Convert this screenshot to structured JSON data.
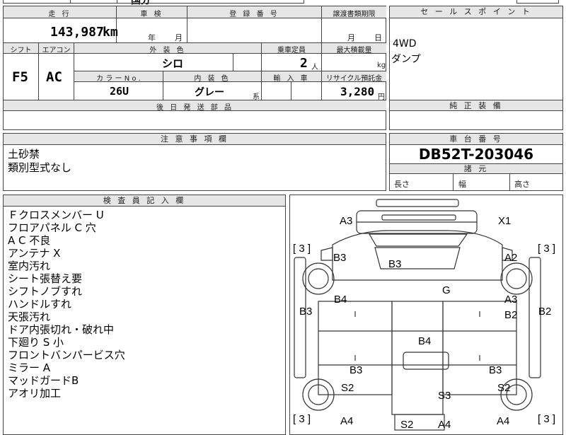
{
  "top_bar": {
    "partial_text": "国分"
  },
  "spec": {
    "headers": {
      "mileage": "走 行",
      "shaken": "車 検",
      "registration": "登 録 番 号",
      "transfer_deadline": "譲渡書類期限",
      "shift": "シフト",
      "aircon": "エアコン",
      "exterior_color": "外 装 色",
      "capacity": "乗車定員",
      "max_load": "最大積載量",
      "color_no": "カ ラ ー N o .",
      "interior_color": "内 装 色",
      "import": "輸 入 車",
      "recycle": "リサイクル預託金",
      "later_parts": "後 日 発 送 部 品"
    },
    "mileage_value": "143,987",
    "mileage_unit": "km",
    "shaken_year": "年",
    "shaken_month": "月",
    "transfer_month": "月",
    "transfer_day": "日",
    "shift_value": "F5",
    "aircon_value": "AC",
    "exterior_color_value": "シロ",
    "capacity_value": "2",
    "capacity_unit": "人",
    "load_unit": "kg",
    "color_no_value": "26U",
    "interior_color_value": "グレー",
    "interior_color_suffix": "系",
    "recycle_value": "3,280",
    "recycle_unit": "円"
  },
  "sales_points": {
    "header": "セ ー ル ス ポ イ ン ト",
    "lines": [
      "4WD",
      "ダンプ"
    ]
  },
  "genuine_equipment": {
    "header": "純 正 装 備"
  },
  "notes": {
    "header": "注 意 事 項 欄",
    "lines": [
      "土砂禁",
      "類別型式なし"
    ]
  },
  "chassis": {
    "header": "車 台 番 号",
    "number": "DB52T-203046"
  },
  "dimensions": {
    "header": "諸 元",
    "length": "長さ",
    "width": "幅",
    "height": "高さ"
  },
  "inspector": {
    "header": "検 査 員 記 入 欄",
    "lines": [
      "Ｆクロスメンバー U",
      "フロアパネル C 穴",
      "A C 不良",
      "アンテナ X",
      "室内汚れ",
      "シート張替え要",
      "シフトノブすれ",
      "ハンドルすれ",
      "天張汚れ",
      "ドア内張切れ・破れ中",
      "下廻り S 小",
      "フロントバンパービス穴",
      "ミラー A",
      "マッドガードB",
      "アオリ加工"
    ]
  },
  "diagram": {
    "tyre_labels": [
      "[ 3 ]",
      "[ 3 ]",
      "[ 3 ]",
      "[ 3 ]"
    ],
    "marks": [
      "A3",
      "X1",
      "B3",
      "A2",
      "B3",
      "G",
      "B3",
      "B4",
      "A3",
      "B2",
      "B2",
      "B4",
      "B3",
      "B3",
      "S2",
      "S3",
      "S2",
      "A4",
      "S2",
      "A4",
      "A4"
    ]
  }
}
